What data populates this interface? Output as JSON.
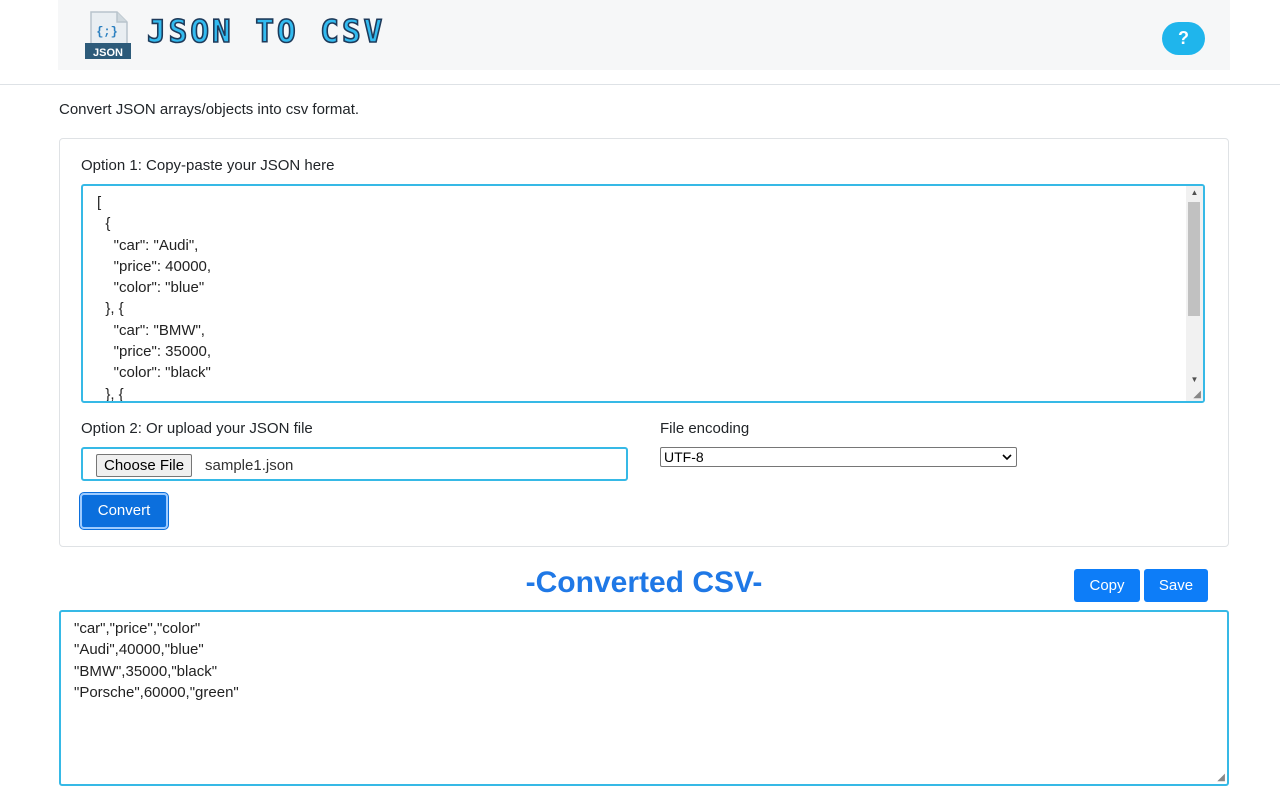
{
  "header": {
    "logo": {
      "icon": "json-file-icon",
      "icon_glyph": "{;}",
      "icon_badge": "JSON",
      "title": "JSON TO CSV"
    },
    "help_label": "?"
  },
  "intro_text": "Convert JSON arrays/objects into csv format.",
  "option1": {
    "label": "Option 1: Copy-paste your JSON here",
    "json_lines": [
      "[",
      "  {",
      "    \"car\": \"Audi\",",
      "    \"price\": 40000,",
      "    \"color\": \"blue\"",
      "  }, {",
      "    \"car\": \"BMW\",",
      "    \"price\": 35000,",
      "    \"color\": \"black\"",
      "  }, {"
    ]
  },
  "option2": {
    "label": "Option 2: Or upload your JSON file",
    "choose_file_label": "Choose File",
    "file_name": "sample1.json"
  },
  "encoding": {
    "label": "File encoding",
    "selected": "UTF-8"
  },
  "convert_label": "Convert",
  "output": {
    "heading": "-Converted CSV-",
    "copy_label": "Copy",
    "save_label": "Save",
    "csv_lines": [
      "\"car\",\"price\",\"color\"",
      "\"Audi\",40000,\"blue\"",
      "\"BMW\",35000,\"black\"",
      "\"Porsche\",60000,\"green\""
    ]
  },
  "colors": {
    "accent_blue": "#0d7df8",
    "title_cyan": "#33bbf0",
    "heading_blue": "#1f78e6",
    "input_border": "#36b9e6"
  }
}
